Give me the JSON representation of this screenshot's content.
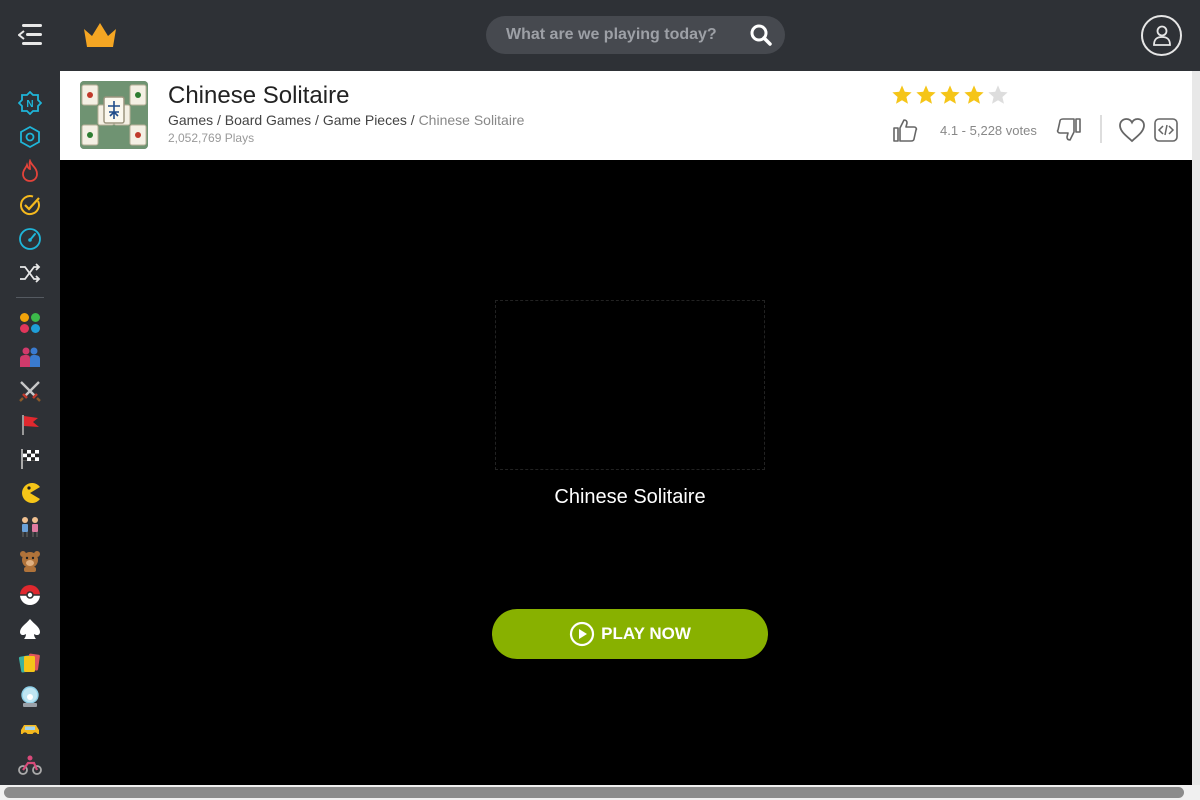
{
  "header": {
    "search_placeholder": "What are we playing today?",
    "icons": [
      "menu-icon",
      "crown-logo-icon",
      "search-icon",
      "user-icon"
    ]
  },
  "sidebar": {
    "items": [
      {
        "icon": "new-icon",
        "color": "#1fb5d8"
      },
      {
        "icon": "atom-icon",
        "color": "#1fb5d8"
      },
      {
        "icon": "fire-icon",
        "color": "#e4433a"
      },
      {
        "icon": "check-clock-icon",
        "color": "#f5b91e"
      },
      {
        "icon": "speedometer-icon",
        "color": "#1fb5d8"
      },
      {
        "icon": "shuffle-icon",
        "color": "#e8e8e8"
      },
      {
        "icon": "dots-icon",
        "color": "#f0a30a"
      },
      {
        "icon": "two-players-icon",
        "color": "#d03a6b"
      },
      {
        "icon": "swords-icon",
        "color": "#bbbbbb"
      },
      {
        "icon": "flag-icon",
        "color": "#e0282e"
      },
      {
        "icon": "checkered-flag-icon",
        "color": "#ffffff"
      },
      {
        "icon": "pacman-icon",
        "color": "#f5c518"
      },
      {
        "icon": "kids-icon",
        "color": "#6aa0d8"
      },
      {
        "icon": "teddy-bear-icon",
        "color": "#b0733a"
      },
      {
        "icon": "pokeball-icon",
        "color": "#e0282e"
      },
      {
        "icon": "spade-icon",
        "color": "#ffffff"
      },
      {
        "icon": "cards-icon",
        "color": "#e0565b"
      },
      {
        "icon": "snow-globe-icon",
        "color": "#8fd0e8"
      },
      {
        "icon": "car-icon",
        "color": "#f5b91e"
      },
      {
        "icon": "motorbike-icon",
        "color": "#d84a7a"
      }
    ]
  },
  "game": {
    "title": "Chinese Solitaire",
    "breadcrumb": [
      "Games",
      "Board Games",
      "Game Pieces"
    ],
    "breadcrumb_current": "Chinese Solitaire",
    "plays": "2,052,769 Plays",
    "rating": 4.1,
    "stars_filled": 4,
    "stars_total": 5,
    "votes_text": "4.1 - 5,228 votes"
  },
  "player": {
    "splash_title": "Chinese Solitaire",
    "play_label": "PLAY NOW",
    "play_color": "#88b100"
  },
  "colors": {
    "topbar": "#2e3136",
    "star_filled": "#f5c518",
    "star_empty": "#dddddd"
  }
}
